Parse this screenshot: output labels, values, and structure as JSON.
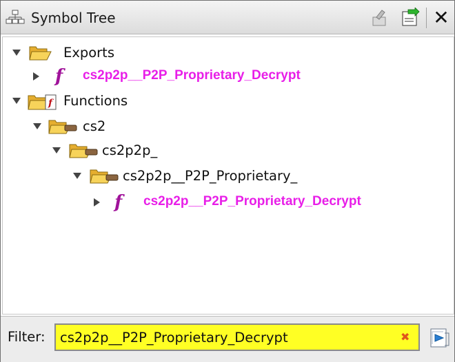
{
  "panel": {
    "title": "Symbol Tree",
    "icons": {
      "title": "symbol-tree-icon",
      "navigate": "navigate-on-incoming-event-icon",
      "create_snapshot": "snapshot-icon",
      "close": "close-icon"
    },
    "close_glyph": "✕"
  },
  "tree": {
    "nodes": [
      {
        "label": "Exports",
        "type": "folder",
        "expanded": true,
        "depth": 0
      },
      {
        "label": "cs2p2p__P2P_Proprietary_Decrypt",
        "type": "function",
        "expanded": false,
        "depth": 1
      },
      {
        "label": "Functions",
        "type": "functions-folder",
        "expanded": true,
        "depth": 0
      },
      {
        "label": "cs2",
        "type": "namespace",
        "expanded": true,
        "depth": 1
      },
      {
        "label": "cs2p2p_",
        "type": "namespace",
        "expanded": true,
        "depth": 2
      },
      {
        "label": "cs2p2p__P2P_Proprietary_",
        "type": "namespace",
        "expanded": true,
        "depth": 3
      },
      {
        "label": "cs2p2p__P2P_Proprietary_Decrypt",
        "type": "function",
        "expanded": false,
        "depth": 4
      }
    ],
    "function_glyph": "f"
  },
  "filter": {
    "label": "Filter:",
    "value": "cs2p2p__P2P_Proprietary_Decrypt",
    "clear_glyph": "✖",
    "input_bg": "#ffff24",
    "options_icon": "filter-options-icon"
  },
  "colors": {
    "function_text": "#e81ee8",
    "function_icon": "#a0139a",
    "folder": "#f2c94c"
  }
}
